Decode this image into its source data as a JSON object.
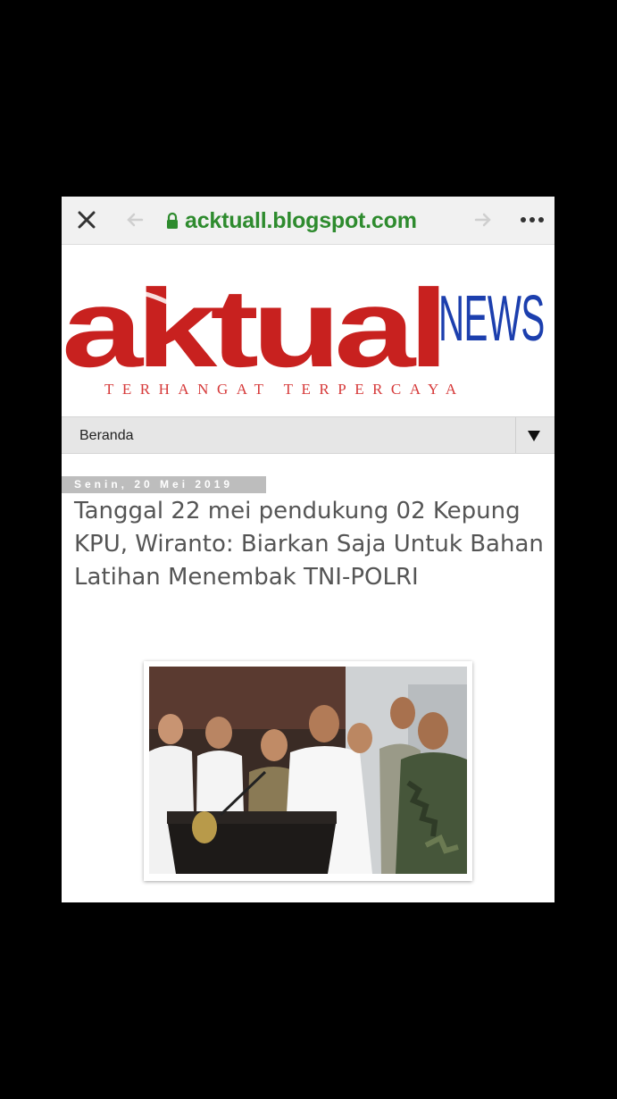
{
  "browser": {
    "url": "acktuall.blogspot.com",
    "icons": {
      "close": "close-icon",
      "back": "arrow-left-icon",
      "forward": "arrow-right-icon",
      "menu": "more-horizontal-icon",
      "lock": "lock-icon"
    }
  },
  "header": {
    "logo_word": "aktual",
    "logo_news": "NEWS",
    "tagline": "TERHANGAT TERPERCAYA",
    "colors": {
      "logo_red": "#c8211f",
      "logo_blue": "#1c3fae"
    }
  },
  "nav": {
    "selected": "Beranda",
    "icon": "triangle-down-icon"
  },
  "article": {
    "date": "Senin, 20 Mei 2019",
    "title": "Tanggal 22 mei pendukung 02 Kepung KPU, Wiranto: Biarkan Saja Untuk Bahan Latihan Menembak TNI-POLRI",
    "image": "press-conference-photo"
  }
}
